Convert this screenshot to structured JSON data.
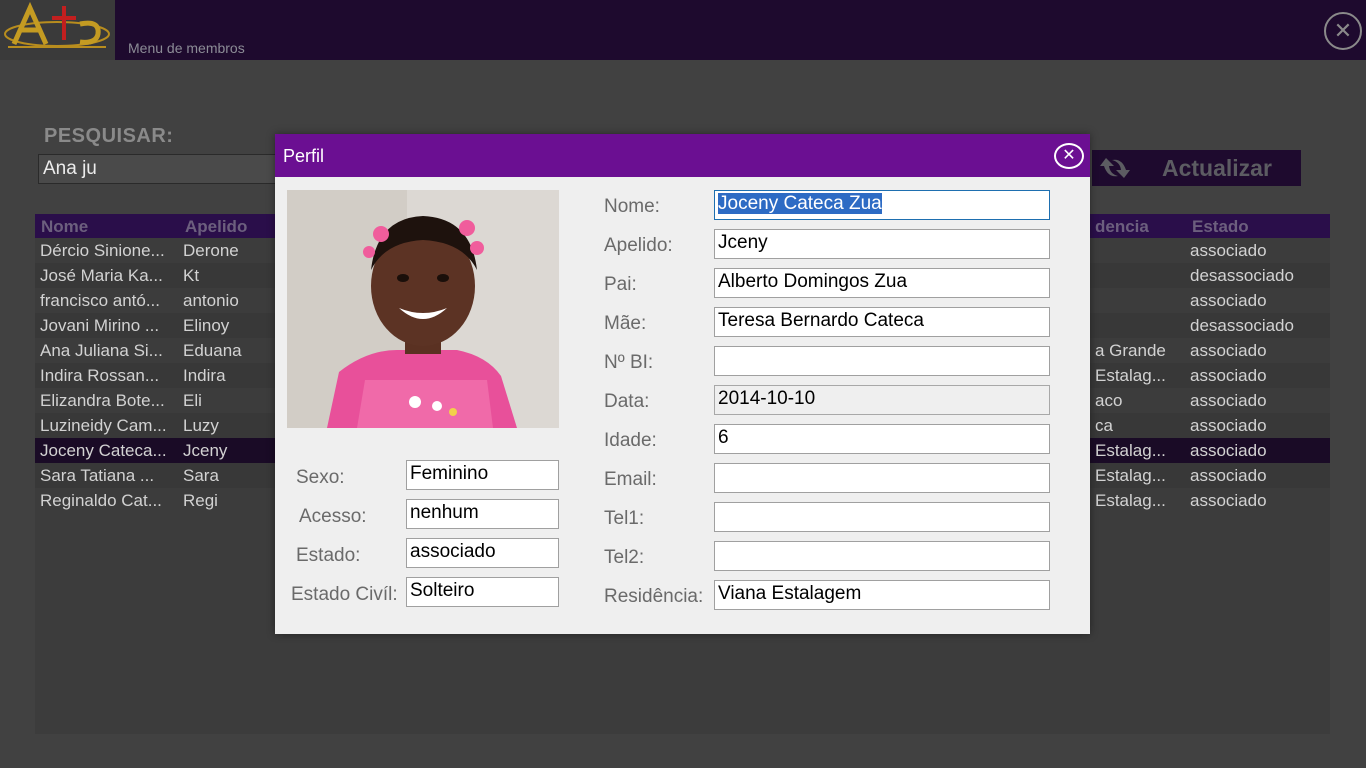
{
  "header": {
    "menu_label": "Menu de membros",
    "close_icon": "close-icon"
  },
  "search": {
    "label": "PESQUISAR:",
    "value": "Ana ju"
  },
  "refresh": {
    "label": "Actualizar",
    "icon": "refresh-icon"
  },
  "table": {
    "headers": [
      "Nome",
      "Apelido",
      "dencia",
      "Estado"
    ],
    "rows": [
      [
        "Dércio Sinione...",
        "Derone",
        "",
        "associado"
      ],
      [
        "José Maria Ka...",
        "Kt",
        "",
        "desassociado"
      ],
      [
        "francisco antó...",
        "antonio",
        "",
        "associado"
      ],
      [
        "Jovani Mirino ...",
        "Elinoy",
        "",
        "desassociado"
      ],
      [
        "Ana Juliana Si...",
        "Eduana",
        "a Grande",
        "associado"
      ],
      [
        "Indira Rossan...",
        "Indira",
        "Estalag...",
        "associado"
      ],
      [
        "Elizandra Bote...",
        "Eli",
        "aco",
        "associado"
      ],
      [
        "Luzineidy Cam...",
        "Luzy",
        "ca",
        "associado"
      ],
      [
        "Joceny Cateca...",
        "Jceny",
        "Estalag...",
        "associado"
      ],
      [
        "Sara Tatiana ...",
        "Sara",
        "Estalag...",
        "associado"
      ],
      [
        "Reginaldo Cat...",
        "Regi",
        "Estalag...",
        "associado"
      ]
    ],
    "selected_index": 8
  },
  "dialog": {
    "title": "Perfil",
    "close_icon": "close-icon",
    "left_fields": [
      {
        "label": "Sexo:",
        "value": "Feminino"
      },
      {
        "label": "Acesso:",
        "value": "nenhum"
      },
      {
        "label": "Estado:",
        "value": "associado"
      },
      {
        "label": "Estado Civíl:",
        "value": "Solteiro"
      }
    ],
    "right_fields": [
      {
        "label": "Nome:",
        "value": "Joceny Cateca Zua"
      },
      {
        "label": "Apelido:",
        "value": "Jceny"
      },
      {
        "label": "Pai:",
        "value": "Alberto Domingos Zua"
      },
      {
        "label": "Mãe:",
        "value": "Teresa Bernardo Cateca"
      },
      {
        "label": "Nº BI:",
        "value": ""
      },
      {
        "label": "Data:",
        "value": "2014-10-10"
      },
      {
        "label": "Idade:",
        "value": "6"
      },
      {
        "label": "Email:",
        "value": ""
      },
      {
        "label": "Tel1:",
        "value": ""
      },
      {
        "label": "Tel2:",
        "value": ""
      },
      {
        "label": "Residência:",
        "value": "Viana Estalagem"
      }
    ]
  },
  "colors": {
    "accent": "#6b0f92",
    "topbar": "#1e0a2e",
    "background": "#414141"
  }
}
